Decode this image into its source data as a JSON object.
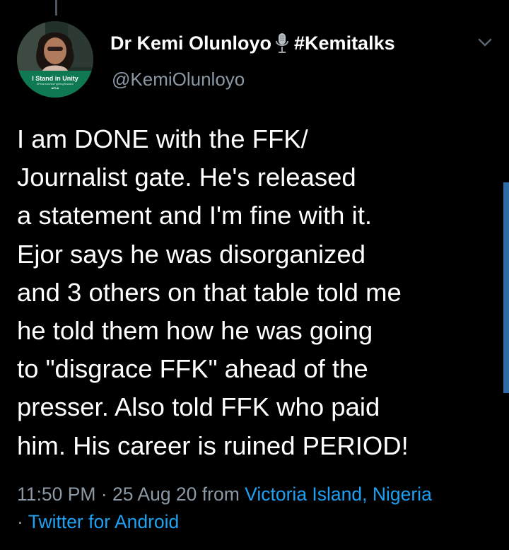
{
  "colors": {
    "background": "#000000",
    "primary_text": "#ffffff",
    "secondary_text": "#8b98a5",
    "link": "#1da1f2",
    "badge_green": "#0f7a52",
    "scrollbar": "#2e6ba4"
  },
  "author": {
    "display_name": "Dr Kemi Olunloyo",
    "emoji_icon": "microphone-icon",
    "hashtag": "#Kemitalks",
    "handle": "@KemiOlunloyo",
    "avatar_badge": {
      "text": "I Stand in Unity",
      "sub": "#PharmacistsFightingRacism",
      "logo": "APhA"
    }
  },
  "tweet": {
    "lines": [
      "I am DONE with the FFK/",
      "Journalist gate. He's released",
      "a statement and I'm fine with it.",
      "Ejor says he was disorganized",
      "and 3 others on that table told me",
      "he told them how he was going",
      "to \"disgrace FFK\" ahead of the",
      "presser. Also told FFK who paid",
      "him. His career is ruined PERIOD!"
    ]
  },
  "meta": {
    "time": "11:50 PM",
    "date": "25 Aug 20",
    "from_label": "from",
    "location": "Victoria Island, Nigeria",
    "separator": "·",
    "client": "Twitter for Android"
  },
  "icons": {
    "more_menu": "chevron-down-icon"
  }
}
